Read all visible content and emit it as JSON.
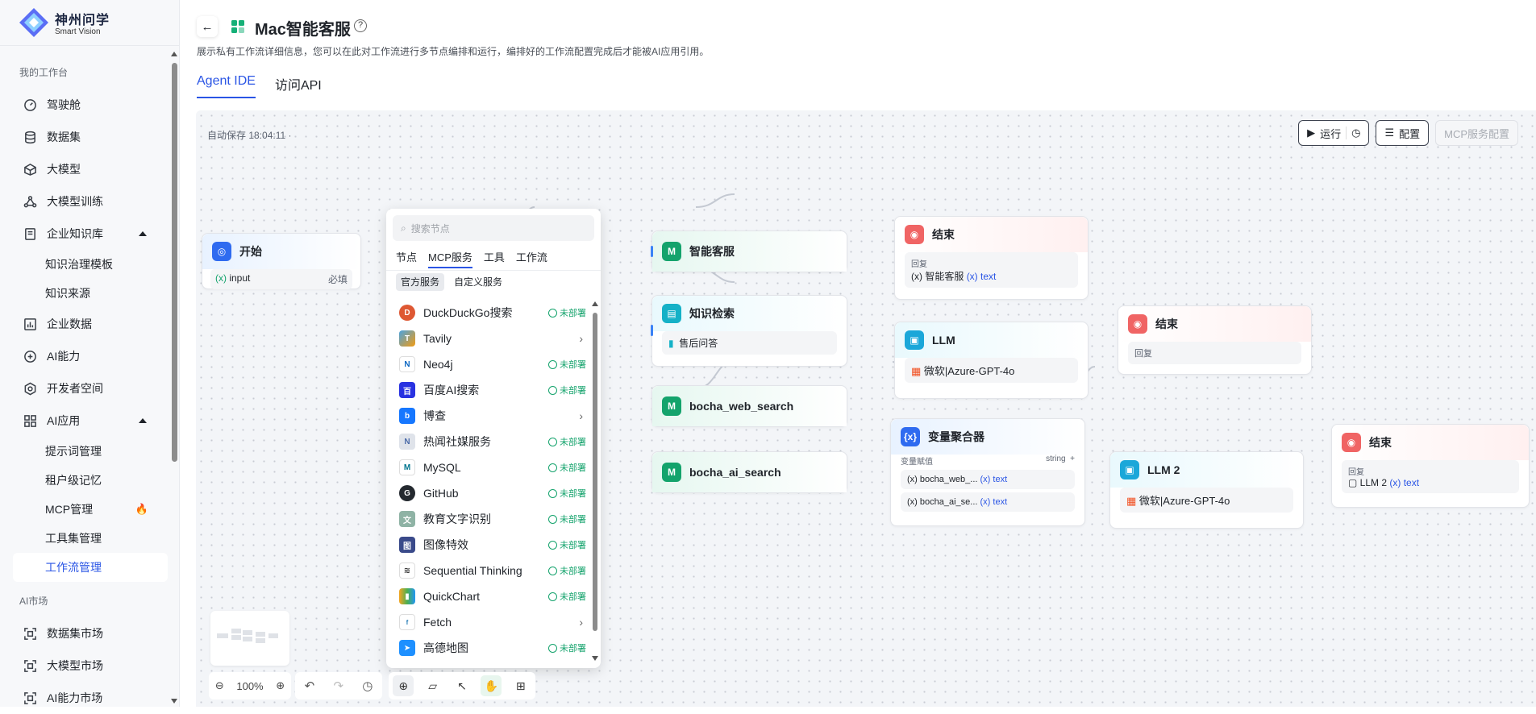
{
  "brand": {
    "name": "神州问学",
    "sub": "Smart Vision"
  },
  "sidebar": {
    "section_workspace": "我的工作台",
    "items": [
      {
        "label": "驾驶舱"
      },
      {
        "label": "数据集"
      },
      {
        "label": "大模型"
      },
      {
        "label": "大模型训练"
      },
      {
        "label": "企业知识库"
      },
      {
        "label": "知识治理模板"
      },
      {
        "label": "知识来源"
      },
      {
        "label": "企业数据"
      },
      {
        "label": "AI能力"
      },
      {
        "label": "开发者空间"
      },
      {
        "label": "AI应用"
      },
      {
        "label": "提示词管理"
      },
      {
        "label": "租户级记忆"
      },
      {
        "label": "MCP管理"
      },
      {
        "label": "工具集管理"
      },
      {
        "label": "工作流管理"
      }
    ],
    "section_market": "AI市场",
    "market_items": [
      {
        "label": "数据集市场"
      },
      {
        "label": "大模型市场"
      },
      {
        "label": "AI能力市场"
      }
    ]
  },
  "header": {
    "title": "Mac智能客服",
    "description": "展示私有工作流详细信息，您可以在此对工作流进行多节点编排和运行，编排好的工作流配置完成后才能被AI应用引用。",
    "tabs": [
      {
        "label": "Agent IDE"
      },
      {
        "label": "访问API"
      }
    ]
  },
  "canvas": {
    "autosave": "自动保存 18:04:11 ·",
    "run_label": "运行",
    "config_label": "配置",
    "mcp_config_label": "MCP服务配置",
    "zoom": "100%"
  },
  "nodes": {
    "start": {
      "title": "开始",
      "var": "input",
      "required": "必填"
    },
    "smart_cs": {
      "title": "智能客服"
    },
    "kb": {
      "title": "知识检索",
      "item": "售后问答"
    },
    "web": {
      "title": "bocha_web_search"
    },
    "ai": {
      "title": "bocha_ai_search"
    },
    "end1": {
      "title": "结束",
      "label": "回复",
      "src": "智能客服",
      "var": "text"
    },
    "llm": {
      "title": "LLM",
      "model": "微软|Azure-GPT-4o"
    },
    "end2": {
      "title": "结束",
      "label": "回复"
    },
    "agg": {
      "title": "变量聚合器",
      "label": "变量赋值",
      "type": "string",
      "r1": "bocha_web_...",
      "r2": "bocha_ai_se...",
      "var": "text"
    },
    "llm2": {
      "title": "LLM 2",
      "model": "微软|Azure-GPT-4o"
    },
    "end3": {
      "title": "结束",
      "label": "回复",
      "src": "LLM 2",
      "var": "text"
    }
  },
  "panel": {
    "search_placeholder": "搜索节点",
    "tabs": [
      {
        "label": "节点"
      },
      {
        "label": "MCP服务"
      },
      {
        "label": "工具"
      },
      {
        "label": "工作流"
      }
    ],
    "subtabs": [
      {
        "label": "官方服务"
      },
      {
        "label": "自定义服务"
      }
    ],
    "status_label": "未部署",
    "services": [
      {
        "name": "DuckDuckGo搜索"
      },
      {
        "name": "Tavily"
      },
      {
        "name": "Neo4j"
      },
      {
        "name": "百度AI搜索"
      },
      {
        "name": "博查"
      },
      {
        "name": "热闻社媒服务"
      },
      {
        "name": "MySQL"
      },
      {
        "name": "GitHub"
      },
      {
        "name": "教育文字识别"
      },
      {
        "name": "图像特效"
      },
      {
        "name": "Sequential Thinking"
      },
      {
        "name": "QuickChart"
      },
      {
        "name": "Fetch"
      },
      {
        "name": "高德地图"
      }
    ]
  }
}
